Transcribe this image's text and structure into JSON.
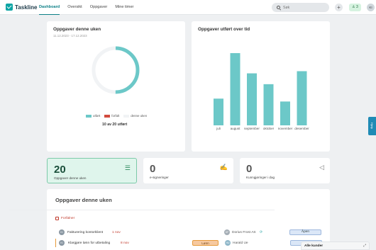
{
  "app": {
    "name": "Taskline"
  },
  "nav": [
    "Dashboard",
    "Oversikt",
    "Oppgaver",
    "Mine timer"
  ],
  "search": {
    "placeholder": "Søk"
  },
  "header": {
    "add_label": "+",
    "badge": "3",
    "avatar": "KI"
  },
  "donut_card": {
    "title": "Oppgaver denne uken",
    "date_range": "11.12.2023 - 17.12.2023",
    "legend": [
      "utført",
      "forfalt",
      "denne uken"
    ],
    "summary": "10 av 20 utført",
    "completed": 10,
    "total": 20
  },
  "bar_card": {
    "title": "Oppgaver utført over tid"
  },
  "chart_data": {
    "type": "bar",
    "title": "Oppgaver utført over tid",
    "categories": [
      "juli",
      "august",
      "september",
      "oktober",
      "november",
      "desember"
    ],
    "values": [
      37,
      100,
      72,
      57,
      33,
      75
    ],
    "ylim": [
      0,
      100
    ],
    "grid": false,
    "color": "#6cc8c8"
  },
  "stats": [
    {
      "value": "20",
      "label": "Oppgaver denne uken"
    },
    {
      "value": "0",
      "label": "e-signeringer"
    },
    {
      "value": "0",
      "label": "Kunngjøringer i dag"
    }
  ],
  "list": {
    "title": "Oppgaver denne uken",
    "section": "Forfalner",
    "rows": [
      {
        "avatar": "KI",
        "name": "Fakturering kontorklient",
        "date": "1 nov",
        "assignee_avatar": "DF",
        "assignee": "Dorius Frost AS",
        "sync": "⟳",
        "status": "",
        "action": "Åpen"
      },
      {
        "avatar": "KI",
        "name": "Klargjøre lønn for utbetaling",
        "date": "8 nov",
        "tag": "Lønn",
        "assignee_avatar": "HU",
        "assignee": "Harald Ue",
        "status": "",
        "action": ""
      }
    ]
  },
  "side_tab": "Hjelp",
  "customers": {
    "label": "Alle kunder",
    "expand": "⤢"
  },
  "colors": {
    "accent": "#0b7f86",
    "done": "#6cc8c8",
    "overdue": "#d24b3e",
    "week": "#f1f3f5"
  }
}
